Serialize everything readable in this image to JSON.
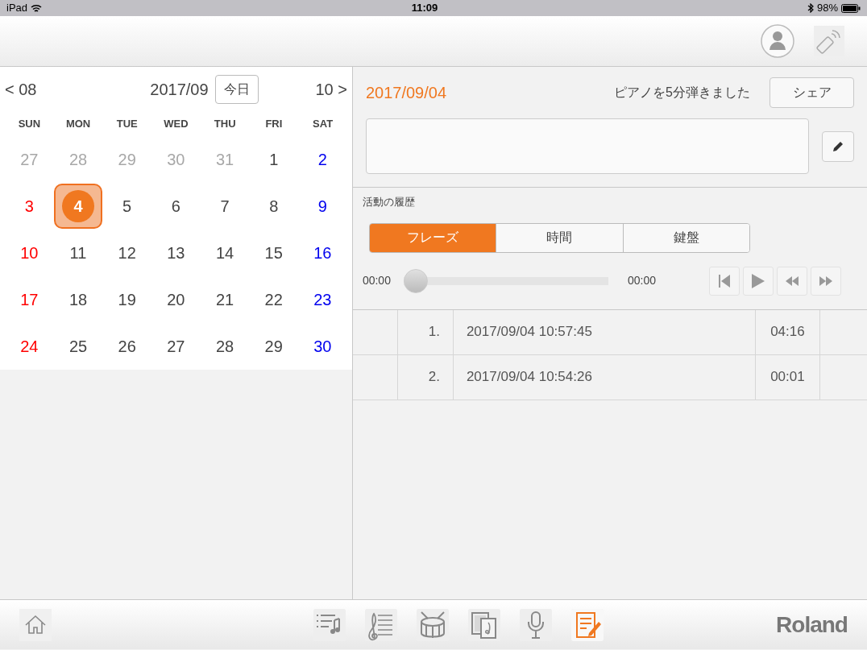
{
  "status_bar": {
    "device": "iPad",
    "time": "11:09",
    "battery": "98%"
  },
  "calendar": {
    "prev": "< 08",
    "month": "2017/09",
    "today_button": "今日",
    "next": "10 >",
    "weekdays": [
      "SUN",
      "MON",
      "TUE",
      "WED",
      "THU",
      "FRI",
      "SAT"
    ],
    "weeks": [
      [
        {
          "label": "27",
          "kind": "muted",
          "selected": false
        },
        {
          "label": "28",
          "kind": "muted",
          "selected": false
        },
        {
          "label": "29",
          "kind": "muted",
          "selected": false
        },
        {
          "label": "30",
          "kind": "muted",
          "selected": false
        },
        {
          "label": "31",
          "kind": "muted",
          "selected": false
        },
        {
          "label": "1",
          "kind": "plain",
          "selected": false
        },
        {
          "label": "2",
          "kind": "saturday",
          "selected": false
        }
      ],
      [
        {
          "label": "3",
          "kind": "sunday",
          "selected": false
        },
        {
          "label": "4",
          "kind": "plain",
          "selected": true
        },
        {
          "label": "5",
          "kind": "plain",
          "selected": false
        },
        {
          "label": "6",
          "kind": "plain",
          "selected": false
        },
        {
          "label": "7",
          "kind": "plain",
          "selected": false
        },
        {
          "label": "8",
          "kind": "plain",
          "selected": false
        },
        {
          "label": "9",
          "kind": "saturday",
          "selected": false
        }
      ],
      [
        {
          "label": "10",
          "kind": "sunday",
          "selected": false
        },
        {
          "label": "11",
          "kind": "plain",
          "selected": false
        },
        {
          "label": "12",
          "kind": "plain",
          "selected": false
        },
        {
          "label": "13",
          "kind": "plain",
          "selected": false
        },
        {
          "label": "14",
          "kind": "plain",
          "selected": false
        },
        {
          "label": "15",
          "kind": "plain",
          "selected": false
        },
        {
          "label": "16",
          "kind": "saturday",
          "selected": false
        }
      ],
      [
        {
          "label": "17",
          "kind": "sunday",
          "selected": false
        },
        {
          "label": "18",
          "kind": "plain",
          "selected": false
        },
        {
          "label": "19",
          "kind": "plain",
          "selected": false
        },
        {
          "label": "20",
          "kind": "plain",
          "selected": false
        },
        {
          "label": "21",
          "kind": "plain",
          "selected": false
        },
        {
          "label": "22",
          "kind": "plain",
          "selected": false
        },
        {
          "label": "23",
          "kind": "saturday",
          "selected": false
        }
      ],
      [
        {
          "label": "24",
          "kind": "sunday",
          "selected": false
        },
        {
          "label": "25",
          "kind": "plain",
          "selected": false
        },
        {
          "label": "26",
          "kind": "plain",
          "selected": false
        },
        {
          "label": "27",
          "kind": "plain",
          "selected": false
        },
        {
          "label": "28",
          "kind": "plain",
          "selected": false
        },
        {
          "label": "29",
          "kind": "plain",
          "selected": false
        },
        {
          "label": "30",
          "kind": "saturday",
          "selected": false
        }
      ]
    ]
  },
  "detail": {
    "date": "2017/09/04",
    "summary": "ピアノを5分弾きました",
    "share_button": "シェア",
    "history_label": "活動の履歴",
    "tabs": [
      {
        "label": "フレーズ",
        "selected": true
      },
      {
        "label": "時間",
        "selected": false
      },
      {
        "label": "鍵盤",
        "selected": false
      }
    ],
    "player": {
      "elapsed": "00:00",
      "total": "00:00",
      "level": 0
    },
    "recordings": [
      {
        "number": "1.",
        "datetime": "2017/09/04 10:57:45",
        "duration": "04:16"
      },
      {
        "number": "2.",
        "datetime": "2017/09/04 10:54:26",
        "duration": "00:01"
      }
    ]
  },
  "toolbar": [
    {
      "kind": "playlist",
      "selected": false
    },
    {
      "kind": "score",
      "selected": false
    },
    {
      "kind": "drum",
      "selected": false
    },
    {
      "kind": "flashcard",
      "selected": false
    },
    {
      "kind": "mic",
      "selected": false
    },
    {
      "kind": "diary",
      "selected": true
    }
  ],
  "logo": "Roland"
}
